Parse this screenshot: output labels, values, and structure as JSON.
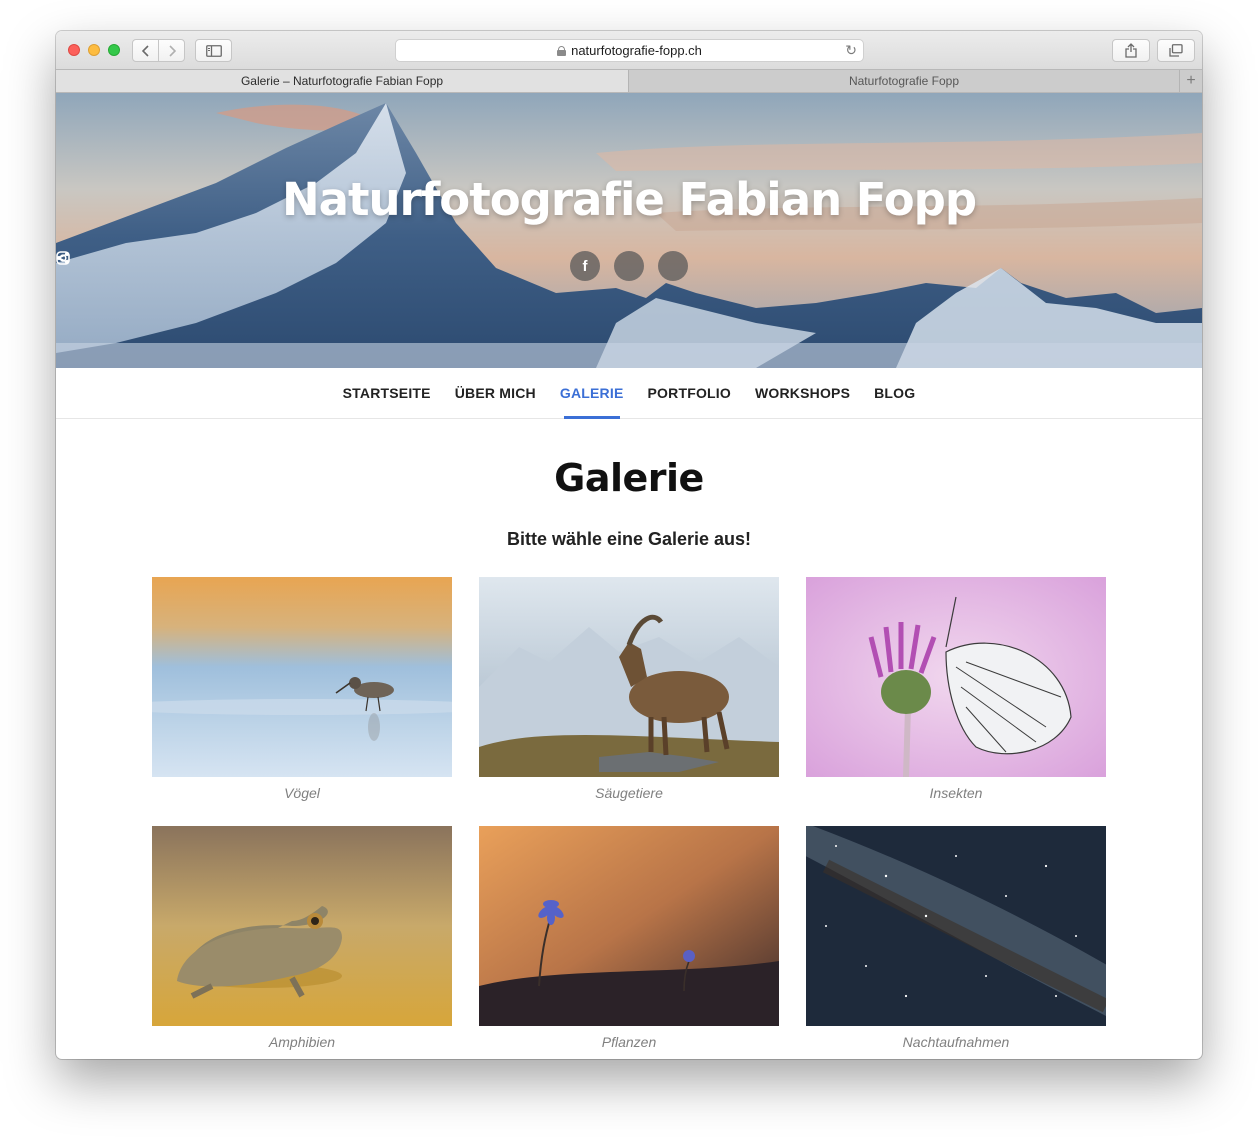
{
  "browser": {
    "url": "naturfotografie-fopp.ch",
    "tabs": [
      {
        "label": "Galerie – Naturfotografie Fabian Fopp",
        "active": true
      },
      {
        "label": "Naturfotografie Fopp",
        "active": false
      }
    ]
  },
  "hero": {
    "site_title": "Naturfotografie Fabian Fopp",
    "social_icons": [
      "facebook-icon",
      "instagram-icon",
      "share-icon"
    ]
  },
  "nav": {
    "items": [
      {
        "label": "STARTSEITE"
      },
      {
        "label": "ÜBER MICH"
      },
      {
        "label": "GALERIE"
      },
      {
        "label": "PORTFOLIO"
      },
      {
        "label": "WORKSHOPS"
      },
      {
        "label": "BLOG"
      }
    ],
    "active_item": "GALERIE"
  },
  "page": {
    "heading": "Galerie",
    "subheading": "Bitte wähle eine Galerie aus!"
  },
  "galleries": [
    {
      "label": "Vögel"
    },
    {
      "label": "Säugetiere"
    },
    {
      "label": "Insekten"
    },
    {
      "label": "Amphibien"
    },
    {
      "label": "Pflanzen"
    },
    {
      "label": "Nachtaufnahmen"
    }
  ],
  "colors": {
    "accent": "#3b6fd6"
  }
}
